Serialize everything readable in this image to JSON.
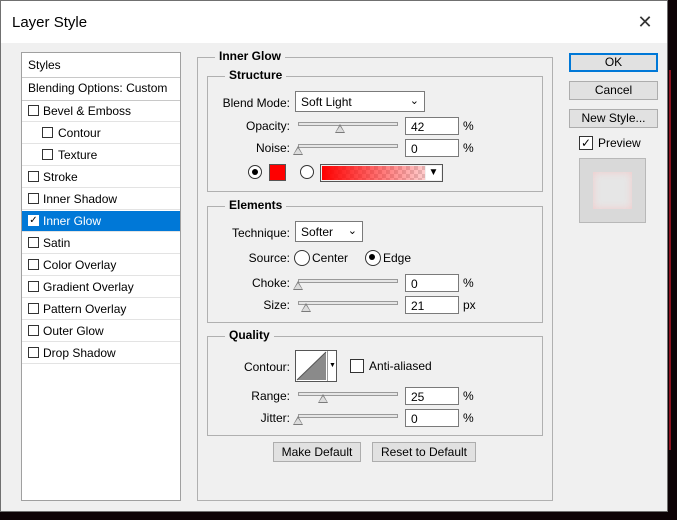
{
  "window": {
    "title": "Layer Style",
    "close_glyph": "✕"
  },
  "styles_panel": {
    "header": "Styles",
    "blending_options": "Blending Options: Custom",
    "items": [
      {
        "label": "Bevel & Emboss",
        "checked": false,
        "indent": false
      },
      {
        "label": "Contour",
        "checked": false,
        "indent": true
      },
      {
        "label": "Texture",
        "checked": false,
        "indent": true
      },
      {
        "label": "Stroke",
        "checked": false,
        "indent": false
      },
      {
        "label": "Inner Shadow",
        "checked": false,
        "indent": false
      },
      {
        "label": "Inner Glow",
        "checked": true,
        "indent": false,
        "selected": true
      },
      {
        "label": "Satin",
        "checked": false,
        "indent": false
      },
      {
        "label": "Color Overlay",
        "checked": false,
        "indent": false
      },
      {
        "label": "Gradient Overlay",
        "checked": false,
        "indent": false
      },
      {
        "label": "Pattern Overlay",
        "checked": false,
        "indent": false
      },
      {
        "label": "Outer Glow",
        "checked": false,
        "indent": false
      },
      {
        "label": "Drop Shadow",
        "checked": false,
        "indent": false
      }
    ]
  },
  "inner_glow": {
    "title": "Inner Glow",
    "structure": {
      "title": "Structure",
      "blend_mode_label": "Blend Mode:",
      "blend_mode_value": "Soft Light",
      "opacity_label": "Opacity:",
      "opacity_value": "42",
      "opacity_unit": "%",
      "opacity_fraction": 0.42,
      "noise_label": "Noise:",
      "noise_value": "0",
      "noise_unit": "%",
      "noise_fraction": 0,
      "glow_color": "#ff0000",
      "color_mode_selected": "color"
    },
    "elements": {
      "title": "Elements",
      "technique_label": "Technique:",
      "technique_value": "Softer",
      "source_label": "Source:",
      "source_center": "Center",
      "source_edge": "Edge",
      "source_selected": "edge",
      "choke_label": "Choke:",
      "choke_value": "0",
      "choke_unit": "%",
      "choke_fraction": 0,
      "size_label": "Size:",
      "size_value": "21",
      "size_unit": "px",
      "size_fraction": 0.084
    },
    "quality": {
      "title": "Quality",
      "contour_label": "Contour:",
      "anti_aliased_label": "Anti-aliased",
      "anti_aliased": false,
      "range_label": "Range:",
      "range_value": "25",
      "range_unit": "%",
      "range_fraction": 0.25,
      "jitter_label": "Jitter:",
      "jitter_value": "0",
      "jitter_unit": "%",
      "jitter_fraction": 0
    },
    "make_default": "Make Default",
    "reset_default": "Reset to Default"
  },
  "right_panel": {
    "ok": "OK",
    "cancel": "Cancel",
    "new_style": "New Style...",
    "preview_label": "Preview",
    "preview_checked": true
  },
  "colors": {
    "accent": "#0078d7",
    "glow": "#ff0000"
  }
}
